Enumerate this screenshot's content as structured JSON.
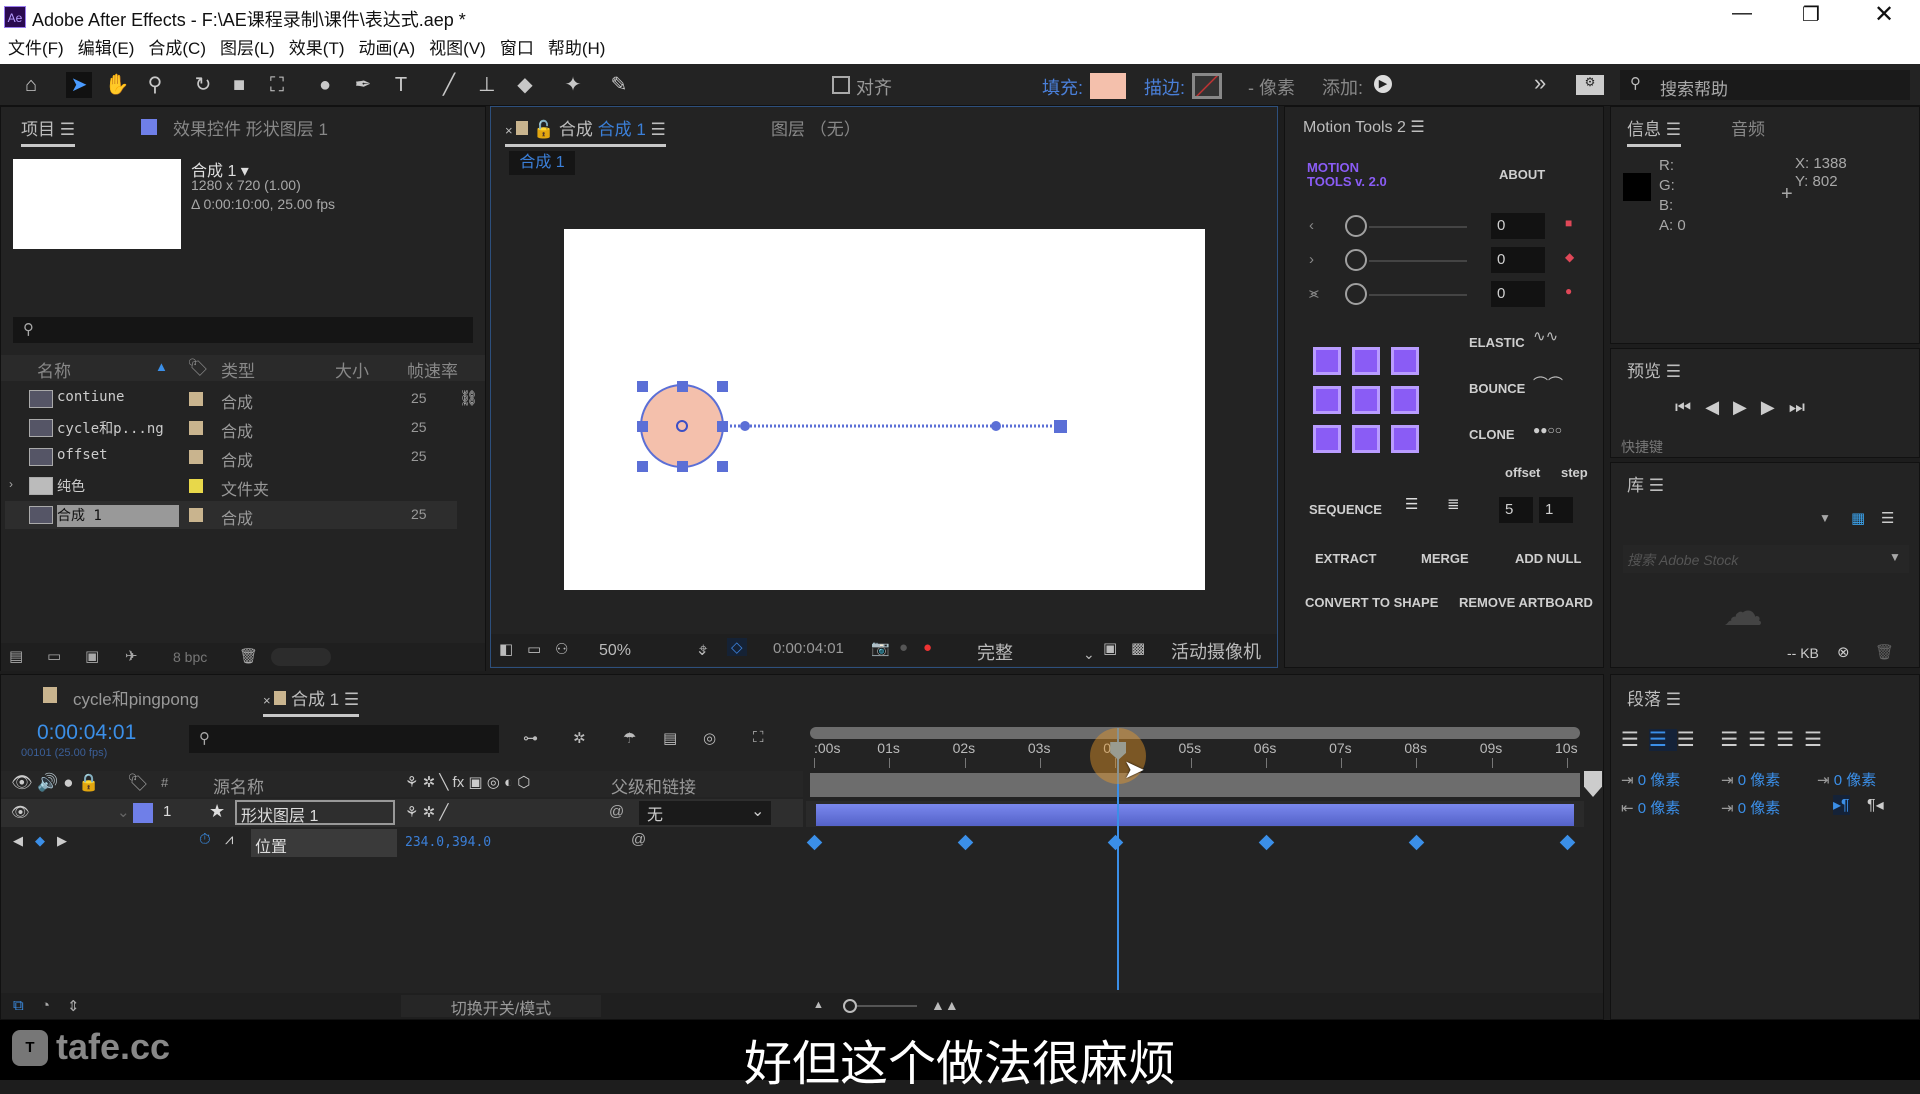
{
  "window": {
    "title": "Adobe After Effects - F:\\AE课程录制\\课件\\表达式.aep *",
    "app_icon": "Ae"
  },
  "menu": [
    "文件(F)",
    "编辑(E)",
    "合成(C)",
    "图层(L)",
    "效果(T)",
    "动画(A)",
    "视图(V)",
    "窗口",
    "帮助(H)"
  ],
  "toolbar": {
    "align_label": "对齐",
    "fill_label": "填充:",
    "fill_color": "#f4c0ac",
    "stroke_label": "描边:",
    "stroke_px": "- 像素",
    "add_label": "添加:",
    "search_placeholder": "搜索帮助"
  },
  "project": {
    "tab": "项目",
    "effects_tab": "效果控件 形状图层 1",
    "comp_name": "合成 1",
    "comp_size": "1280 x 720 (1.00)",
    "comp_duration": "Δ 0:00:10:00, 25.00 fps",
    "columns": [
      "名称",
      "类型",
      "大小",
      "帧速率"
    ],
    "items": [
      {
        "name": "contiune",
        "type": "合成",
        "fps": "25",
        "label_color": "#c9b48e",
        "kind": "comp"
      },
      {
        "name": "cycle和p...ng",
        "type": "合成",
        "fps": "25",
        "label_color": "#c9b48e",
        "kind": "comp"
      },
      {
        "name": "offset",
        "type": "合成",
        "fps": "25",
        "label_color": "#c9b48e",
        "kind": "comp"
      },
      {
        "name": "纯色",
        "type": "文件夹",
        "fps": "",
        "label_color": "#e8d84a",
        "kind": "folder"
      },
      {
        "name": "合成 1",
        "type": "合成",
        "fps": "25",
        "label_color": "#c9b48e",
        "kind": "comp",
        "selected": true
      }
    ],
    "bpc": "8 bpc"
  },
  "viewer": {
    "tab_prefix": "合成",
    "tab_comp": "合成 1",
    "layer_tab": "图层 （无）",
    "breadcrumb": "合成 1",
    "zoom": "50%",
    "timecode": "0:00:04:01",
    "resolution": "完整",
    "camera": "活动摄像机",
    "shape_fill": "#f4c0ac",
    "handle_color": "#5b6fd6"
  },
  "motion_tools": {
    "title": "Motion Tools 2",
    "logo": "MOTION TOOLS v. 2.0",
    "about": "ABOUT",
    "values": [
      "0",
      "0",
      "0"
    ],
    "elastic": "ELASTIC",
    "bounce": "BOUNCE",
    "clone": "CLONE",
    "offset": "offset",
    "step": "step",
    "sequence": "SEQUENCE",
    "seq_offset": "5",
    "seq_step": "1",
    "extract": "EXTRACT",
    "merge": "MERGE",
    "add_null": "ADD NULL",
    "convert": "CONVERT TO SHAPE",
    "remove_artboard": "REMOVE ARTBOARD",
    "accent": "#8a5cf5"
  },
  "info": {
    "tab": "信息",
    "audio_tab": "音频",
    "r": "R:",
    "g": "G:",
    "b": "B:",
    "a": "A:  0",
    "x": "X: 1388",
    "y": "Y: 802"
  },
  "preview": {
    "tab": "预览",
    "shortcut_cut": "快捷键"
  },
  "library": {
    "tab": "库",
    "search_placeholder": "搜索 Adobe Stock",
    "kb": "-- KB"
  },
  "paragraph": {
    "tab": "段落",
    "px_values": [
      "0 像素",
      "0 像素",
      "0 像素",
      "0 像素",
      "0 像素"
    ]
  },
  "timeline": {
    "tabs": [
      "cycle和pingpong",
      "合成 1"
    ],
    "timecode": "0:00:04:01",
    "frame_info": "00101 (25.00 fps)",
    "columns": {
      "source": "源名称",
      "parent": "父级和链接"
    },
    "layer": {
      "index": "1",
      "name": "形状图层 1",
      "parent": "无",
      "label_color": "#6f7fe8"
    },
    "property": {
      "name": "位置",
      "value": "234.0,394.0"
    },
    "ruler": [
      ":00s",
      "01s",
      "02s",
      "03s",
      "04s",
      "05s",
      "06s",
      "07s",
      "08s",
      "09s",
      "10s"
    ],
    "duration_s": 10,
    "current_time_s": 4.04,
    "keyframes_s": [
      0,
      2,
      4,
      6,
      8,
      10
    ],
    "toggle_label": "切换开关/模式"
  },
  "subtitle": "好但这个做法很麻烦",
  "watermark": "tafe.cc"
}
